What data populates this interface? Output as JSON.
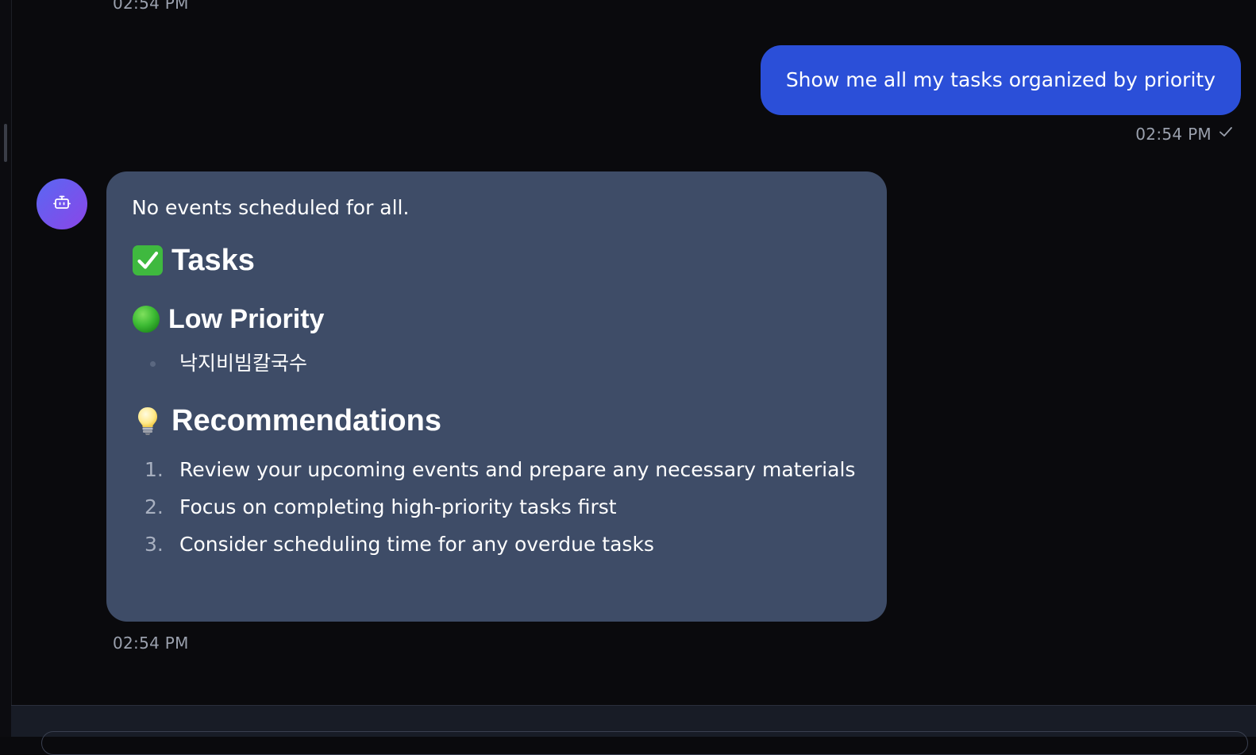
{
  "messages": {
    "top_timestamp": "02:54 PM",
    "user": {
      "text": "Show me all my tasks organized by priority",
      "timestamp": "02:54 PM",
      "status_icon": "checkmark-icon"
    },
    "assistant": {
      "avatar_icon": "robot-icon",
      "intro": "No events scheduled for all.",
      "tasks_heading": {
        "emoji": "✅",
        "text": "Tasks"
      },
      "low_priority_heading": {
        "emoji": "🟢",
        "text": "Low Priority"
      },
      "low_priority_items": [
        "낙지비빔칼국수"
      ],
      "recommendations_heading": {
        "emoji": "💡",
        "text": "Recommendations"
      },
      "recommendations": [
        {
          "num": "1.",
          "text": "Review your upcoming events and prepare any necessary materials"
        },
        {
          "num": "2.",
          "text": "Focus on completing high-priority tasks first"
        },
        {
          "num": "3.",
          "text": "Consider scheduling time for any overdue tasks"
        }
      ],
      "timestamp": "02:54 PM"
    }
  },
  "colors": {
    "background": "#0a0a0d",
    "user_bubble": "#2b4fd8",
    "assistant_bubble": "#3e4c67",
    "timestamp": "#9aa0ad",
    "avatar_gradient_start": "#5a67f2",
    "avatar_gradient_end": "#8a46e8"
  }
}
